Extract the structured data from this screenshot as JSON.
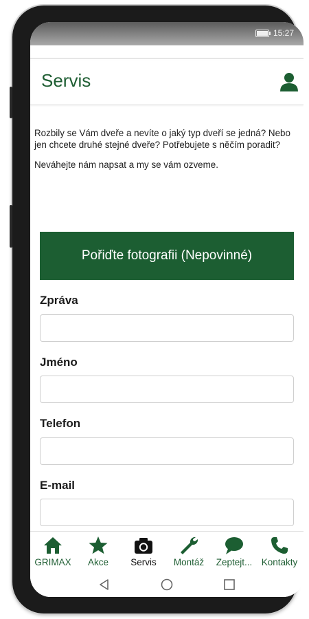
{
  "status_bar": {
    "time": "15:27"
  },
  "app_bar": {
    "title": "Servis"
  },
  "intro": {
    "paragraph1": "Rozbily se Vám dveře a nevíte o jaký typ dveří se jedná? Nebo jen chcete druhé stejné dveře? Potřebujete s něčím poradit?",
    "paragraph2": "Neváhejte nám napsat a my se vám ozveme."
  },
  "photo_button": {
    "label": "Pořiďte fotografii (Nepovinné)"
  },
  "form": {
    "message": {
      "label": "Zpráva",
      "value": "",
      "placeholder": ""
    },
    "name": {
      "label": "Jméno",
      "value": "",
      "placeholder": ""
    },
    "phone": {
      "label": "Telefon",
      "value": "",
      "placeholder": ""
    },
    "email": {
      "label": "E-mail",
      "value": "",
      "placeholder": ""
    }
  },
  "bottom_nav": {
    "items": [
      {
        "label": "GRIMAX",
        "icon": "home-icon"
      },
      {
        "label": "Akce",
        "icon": "star-icon"
      },
      {
        "label": "Servis",
        "icon": "camera-icon",
        "active": true
      },
      {
        "label": "Montáž",
        "icon": "wrench-icon"
      },
      {
        "label": "Zeptejt...",
        "icon": "chat-icon"
      },
      {
        "label": "Kontakty",
        "icon": "phone-icon"
      }
    ]
  },
  "colors": {
    "brand_green": "#1c5e32",
    "text_dark": "#1b1b1b",
    "active_nav": "#111111"
  }
}
